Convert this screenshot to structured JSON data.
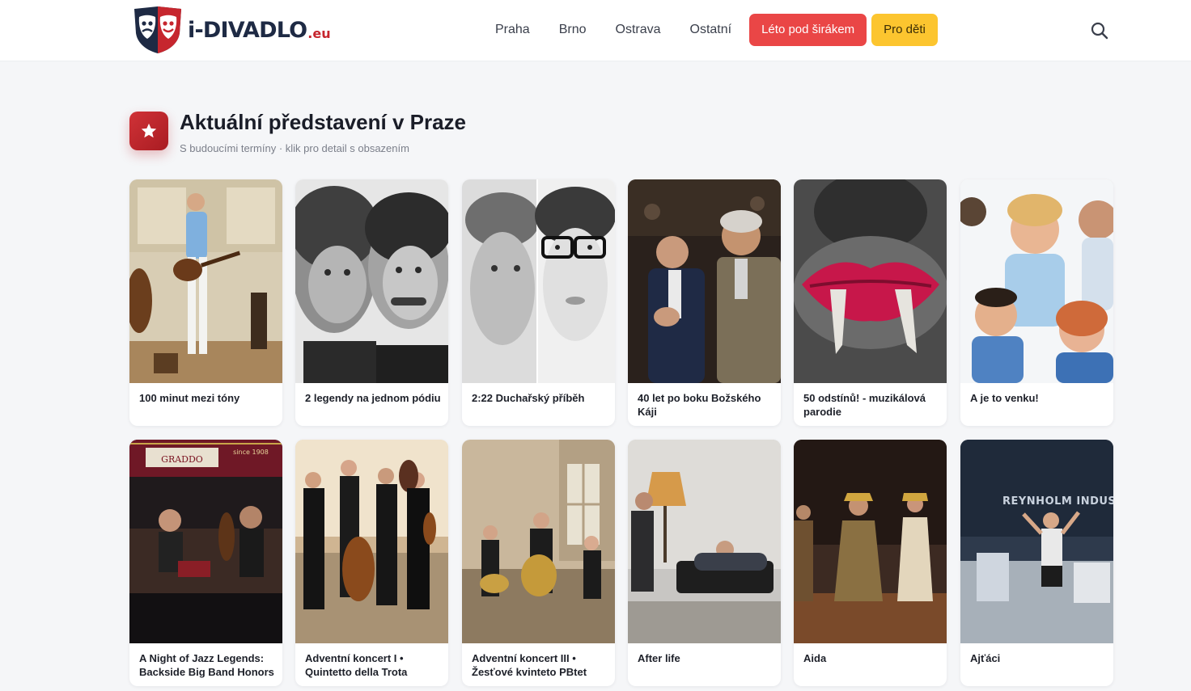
{
  "header": {
    "logo_text": "i-DIVADLO",
    "logo_tld": ".eu",
    "nav": [
      "Praha",
      "Brno",
      "Ostrava",
      "Ostatní"
    ],
    "btn_summer": "Léto pod širákem",
    "btn_kids": "Pro děti",
    "search_icon": "search-icon"
  },
  "section": {
    "icon": "star-icon",
    "title": "Aktuální představení v Praze",
    "subtitle": "S budoucími termíny · klik pro detail s obsazením"
  },
  "cards": [
    {
      "title": "100 minut mezi tóny"
    },
    {
      "title": "2 legendy na jednom pódiu"
    },
    {
      "title": "2:22 Duchařský příběh"
    },
    {
      "title": "40 let po boku Božského Káji"
    },
    {
      "title": "50 odstínů! - muzikálová parodie"
    },
    {
      "title": "A je to venku!"
    },
    {
      "title": "A Night of Jazz Legends: Backside Big Band Honors"
    },
    {
      "title": "Adventní koncert I • Quintetto della Trota"
    },
    {
      "title": "Adventní koncert III • Žesťové kvinteto PBtet"
    },
    {
      "title": "After life"
    },
    {
      "title": "Aida"
    },
    {
      "title": "Ajťáci"
    }
  ],
  "colors": {
    "accent_red": "#ea4646",
    "accent_yellow": "#fcc52f",
    "brand_navy": "#1e2a44",
    "brand_red": "#c6262e"
  },
  "image_text": {
    "card7_banner": "GRADDO",
    "card7_year": "since 1908",
    "card12_sign": "REYNHOLM INDUST"
  }
}
